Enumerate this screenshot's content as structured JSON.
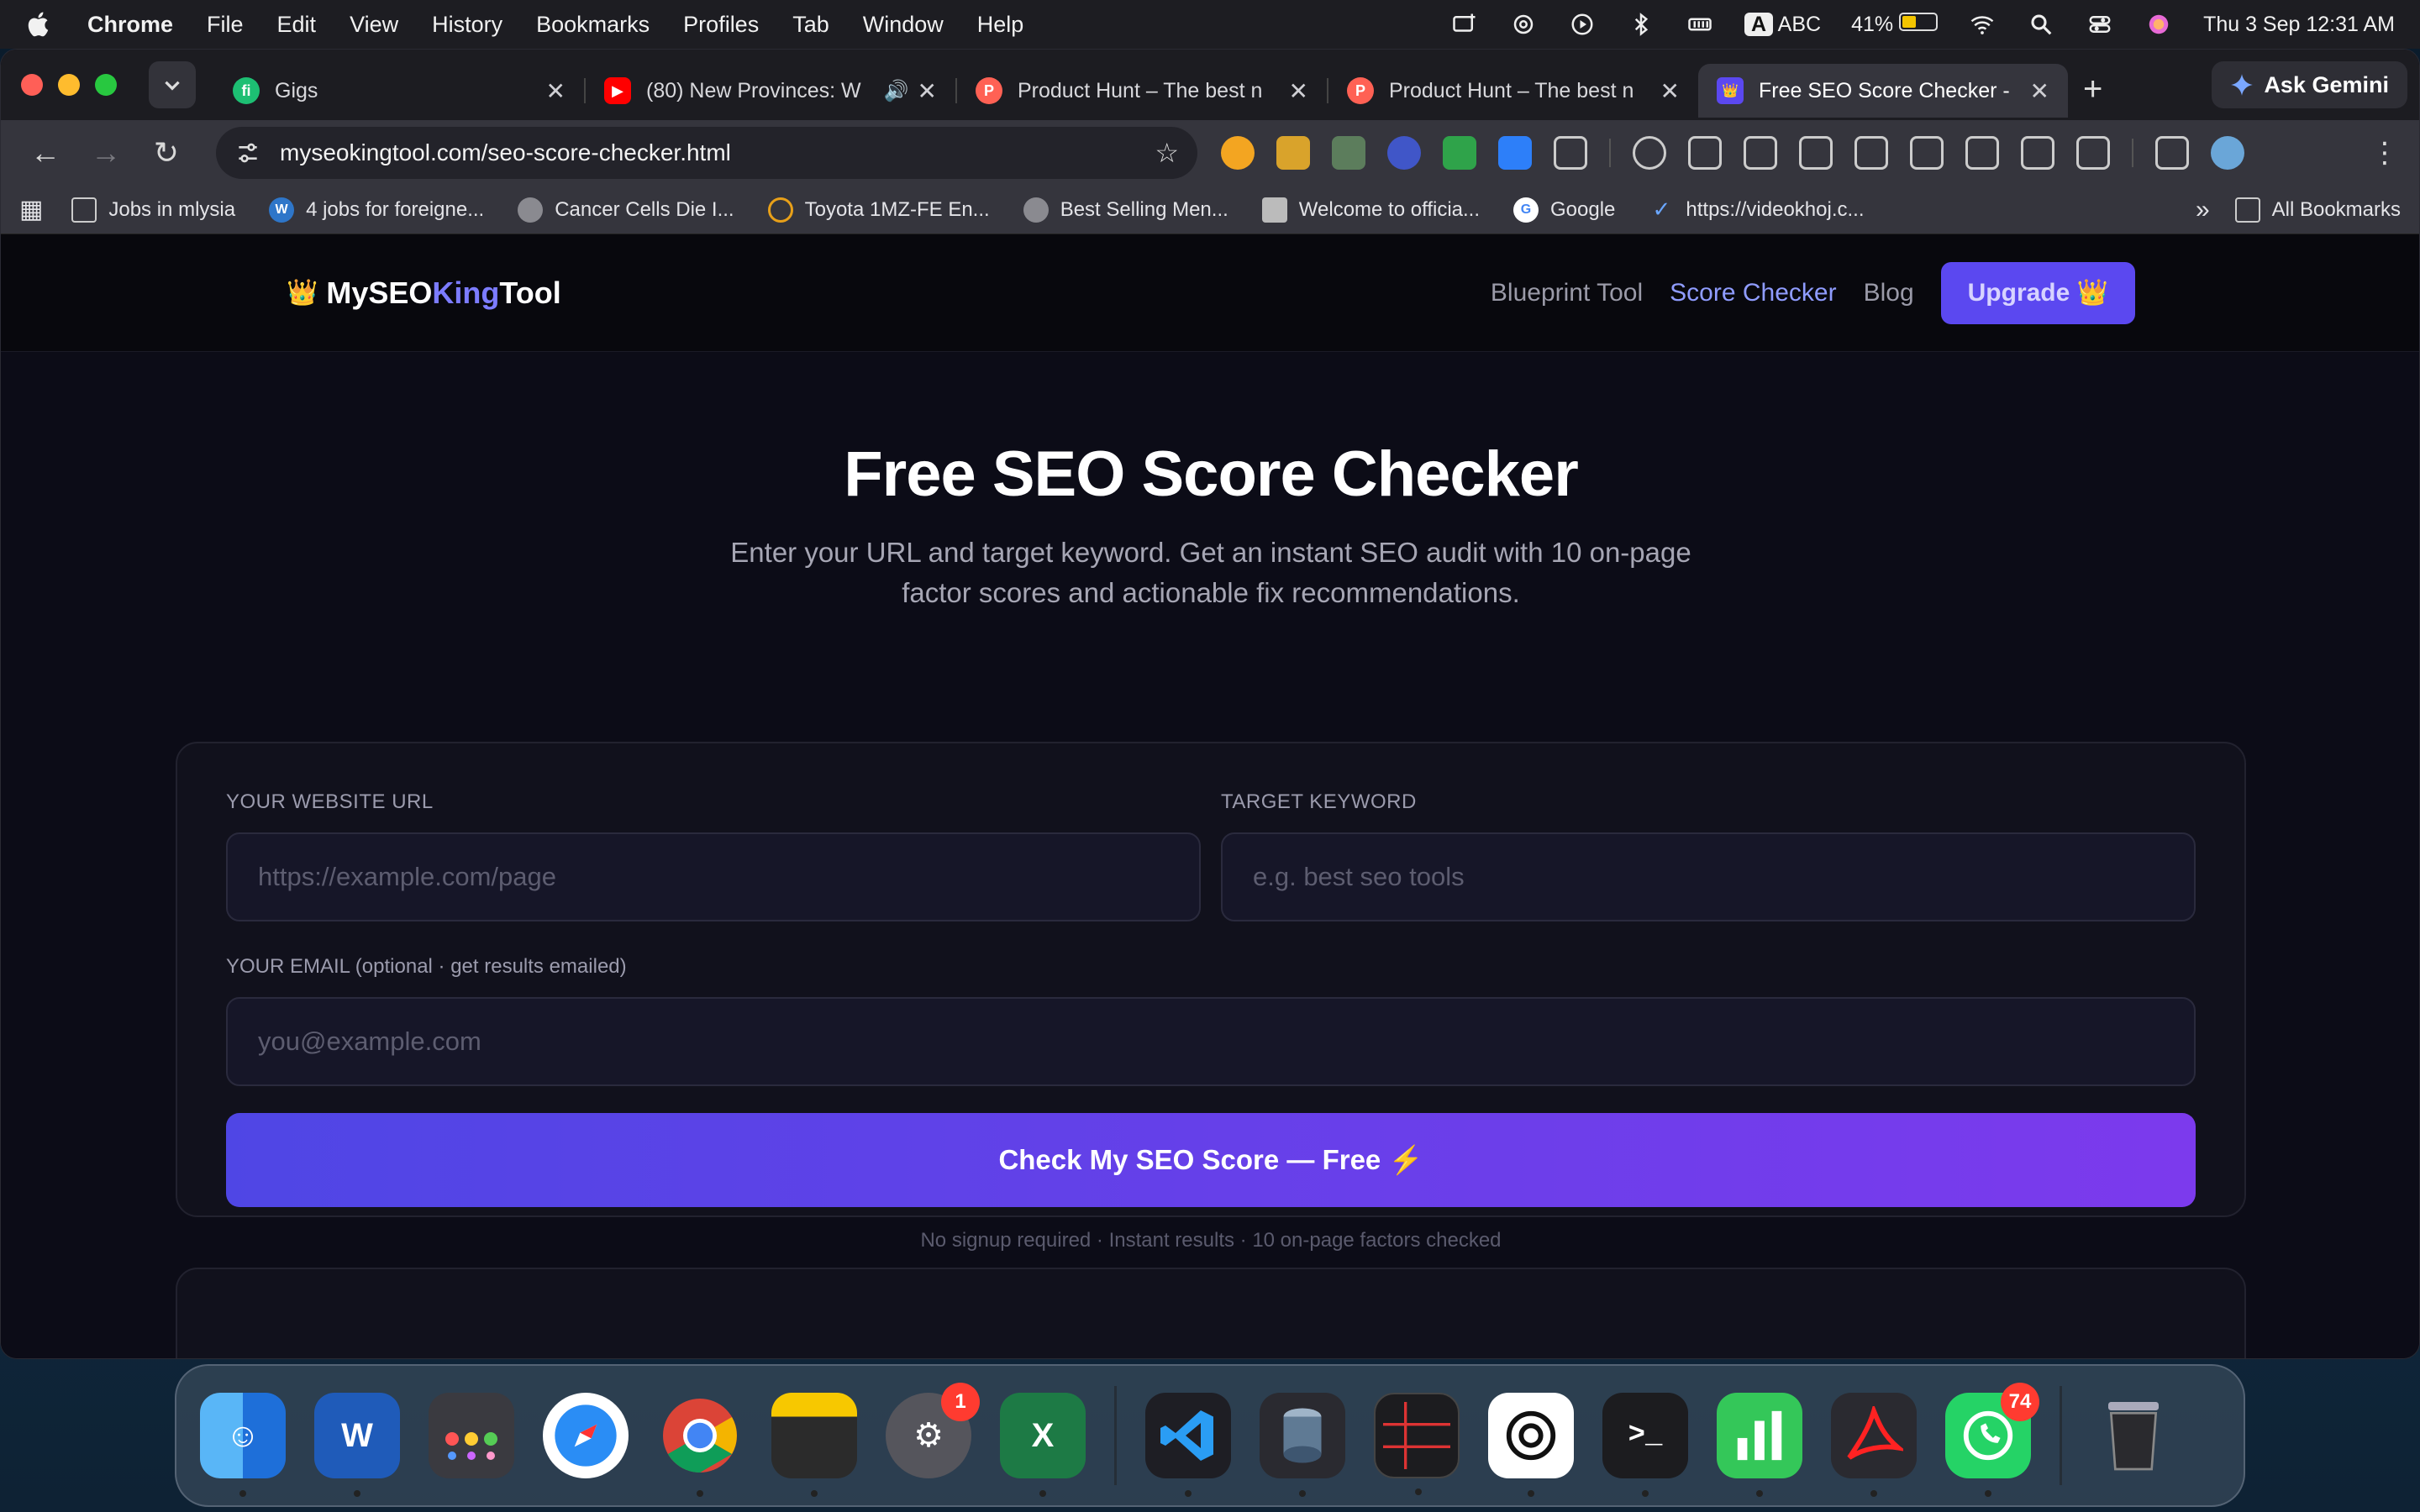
{
  "menubar": {
    "items": [
      "Chrome",
      "File",
      "Edit",
      "View",
      "History",
      "Bookmarks",
      "Profiles",
      "Tab",
      "Window",
      "Help"
    ],
    "input_source": "ABC",
    "input_letter": "A",
    "battery": "41%",
    "datetime": "Thu 3 Sep  12:31 AM"
  },
  "tabs": [
    {
      "label": "Gigs",
      "favicon": "fiverr",
      "active": false
    },
    {
      "label": "(80) New Provinces: W",
      "favicon": "youtube",
      "active": false
    },
    {
      "label": "Product Hunt – The best n",
      "favicon": "producthunt",
      "active": false
    },
    {
      "label": "Product Hunt – The best n",
      "favicon": "producthunt",
      "active": false
    },
    {
      "label": "Free SEO Score Checker -",
      "favicon": "myseoking",
      "active": true
    }
  ],
  "gemini_label": "Ask Gemini",
  "omnibox": {
    "url": "myseokingtool.com/seo-score-checker.html"
  },
  "bookmarks": [
    {
      "label": "Jobs in mlysia",
      "icon": "folder-icon"
    },
    {
      "label": "4 jobs for foreigne...",
      "icon": "wordpress-icon"
    },
    {
      "label": "Cancer Cells Die I...",
      "icon": "globe-icon"
    },
    {
      "label": "Toyota 1MZ-FE En...",
      "icon": "engine-icon"
    },
    {
      "label": "Best Selling Men...",
      "icon": "globe-icon"
    },
    {
      "label": "Welcome to officia...",
      "icon": "site-icon"
    },
    {
      "label": "Google",
      "icon": "google-icon"
    },
    {
      "label": "https://videokhoj.c...",
      "icon": "videokhoj-icon"
    }
  ],
  "all_bookmarks": "All Bookmarks",
  "site": {
    "logo_crown": "👑",
    "logo_a": "MySEO",
    "logo_b": "King",
    "logo_c": "Tool",
    "nav": [
      "Blueprint Tool",
      "Score Checker",
      "Blog"
    ],
    "upgrade": "Upgrade 👑"
  },
  "hero": {
    "title": "Free SEO Score Checker",
    "subtitle": "Enter your URL and target keyword. Get an instant SEO audit with 10 on-page factor scores and actionable fix recommendations."
  },
  "form": {
    "url_label": "YOUR WEBSITE URL",
    "url_placeholder": "https://example.com/page",
    "keyword_label": "TARGET KEYWORD",
    "keyword_placeholder": "e.g. best seo tools",
    "email_label": "YOUR EMAIL (optional · get results emailed)",
    "email_placeholder": "you@example.com",
    "submit": "Check My SEO Score — Free ⚡",
    "note": "No signup required · Instant results · 10 on-page factors checked"
  },
  "dock": {
    "settings_badge": "1",
    "whatsapp_badge": "74"
  },
  "colors": {
    "accent": "#5b48f0",
    "cta_start": "#4f46e5",
    "cta_end": "#7c3aed",
    "page_bg": "#0c0c17"
  }
}
